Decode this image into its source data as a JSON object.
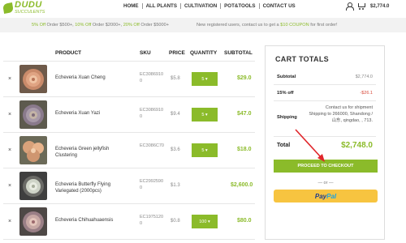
{
  "brand": {
    "name": "DUDU",
    "tagline": "SUCCULENTS"
  },
  "nav": [
    {
      "label": "HOME"
    },
    {
      "label": "ALL PLANTS"
    },
    {
      "label": "CULTIVATION"
    },
    {
      "label": "POT&TOOLS"
    },
    {
      "label": "CONTACT US"
    }
  ],
  "header": {
    "cart_total": "$2,774.0"
  },
  "promo": {
    "left": [
      {
        "text": "5% Off",
        "hl": true
      },
      {
        "text": " Order $500+, ",
        "hl": false
      },
      {
        "text": "10% Off",
        "hl": true
      },
      {
        "text": " Order $2000+, ",
        "hl": false
      },
      {
        "text": "20% Off",
        "hl": true
      },
      {
        "text": " Order $5000+",
        "hl": false
      }
    ],
    "right_before": "New registered users, contact us to get a ",
    "right_hl": "$10 COUPON",
    "right_after": " for first order!"
  },
  "table": {
    "headers": {
      "product": "PRODUCT",
      "sku": "SKU",
      "price": "PRICE",
      "quantity": "QUANTITY",
      "subtotal": "SUBTOTAL"
    },
    "rows": [
      {
        "remove": "×",
        "name": "Echeveria Xuan Cheng",
        "sku": "EC30869100",
        "price": "$5.8",
        "qty": "5",
        "subtotal": "$29.0"
      },
      {
        "remove": "×",
        "name": "Echeveria Xuan Yazi",
        "sku": "EC30869100",
        "price": "$9.4",
        "qty": "5",
        "subtotal": "$47.0"
      },
      {
        "remove": "×",
        "name": "Echeveria Green jellyfish Clustering",
        "sku": "EC3086C70",
        "price": "$3.6",
        "qty": "5",
        "subtotal": "$18.0"
      },
      {
        "remove": "×",
        "name": "Echeveria Butterfly Flying Variegated (2000pcs)",
        "sku": "EC29925900",
        "price": "$1.3",
        "qty": "",
        "subtotal": "$2,600.0"
      },
      {
        "remove": "×",
        "name": "Echeveria Chihuahuaensis",
        "sku": "EC19751200",
        "price": "$0.8",
        "qty": "100",
        "subtotal": "$80.0"
      }
    ]
  },
  "totals": {
    "title": "CART TOTALS",
    "subtotal_label": "Subtotal",
    "subtotal_value": "$2,774.0",
    "discount_label": "15% off",
    "discount_value": "-$26.1",
    "shipping_label": "Shipping",
    "shipping_note": "Contact us for shipment",
    "shipping_line1": "Shipping to 266000, Shandong /",
    "shipping_line2": "山东, qingdao, , 713.",
    "total_label": "Total",
    "total_value": "$2,748.0",
    "checkout_label": "PROCEED TO CHECKOUT",
    "or_label": "— or —",
    "paypal_pay": "Pay",
    "paypal_pal": "Pal"
  },
  "colors": {
    "accent": "#8bbb2a",
    "discount": "#d84a3b",
    "paypal_bg": "#f7c440",
    "arrow": "#e0262b"
  },
  "icons": {
    "account": "user-icon",
    "cart": "cart-icon",
    "remove": "close-icon"
  }
}
